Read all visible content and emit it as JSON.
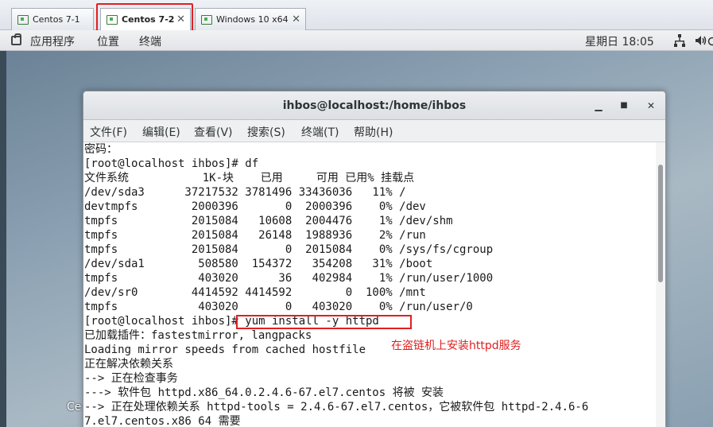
{
  "vm_tabs": [
    {
      "label": "Centos 7-1"
    },
    {
      "label": "Centos 7-2"
    },
    {
      "label": "Windows 10 x64"
    }
  ],
  "gnome_bar": {
    "applications": "应用程序",
    "places": "位置",
    "terminal": "终端",
    "clock": "星期日 18:05"
  },
  "terminal": {
    "title": "ihbos@localhost:/home/ihbos",
    "menu": [
      "文件(F)",
      "编辑(E)",
      "查看(V)",
      "搜索(S)",
      "终端(T)",
      "帮助(H)"
    ],
    "lines": [
      "密码：",
      "[root@localhost ihbos]# df",
      "文件系统           1K-块    已用     可用 已用% 挂载点",
      "/dev/sda3      37217532 3781496 33436036   11% /",
      "devtmpfs        2000396       0  2000396    0% /dev",
      "tmpfs           2015084   10608  2004476    1% /dev/shm",
      "tmpfs           2015084   26148  1988936    2% /run",
      "tmpfs           2015084       0  2015084    0% /sys/fs/cgroup",
      "/dev/sda1        508580  154372   354208   31% /boot",
      "tmpfs            403020      36   402984    1% /run/user/1000",
      "/dev/sr0        4414592 4414592        0  100% /mnt",
      "tmpfs            403020       0   403020    0% /run/user/0",
      "[root@localhost ihbos]# yum install -y httpd",
      "已加载插件：fastestmirror, langpacks",
      "Loading mirror speeds from cached hostfile",
      "正在解决依赖关系",
      "--> 正在检查事务",
      "---> 软件包 httpd.x86_64.0.2.4.6-67.el7.centos 将被 安装",
      "--> 正在处理依赖关系 httpd-tools = 2.4.6-67.el7.centos，它被软件包 httpd-2.4.6-6",
      "7.el7.centos.x86_64 需要"
    ]
  },
  "annotation": "在盗链机上安装httpd服务",
  "left_peek": "Ce"
}
